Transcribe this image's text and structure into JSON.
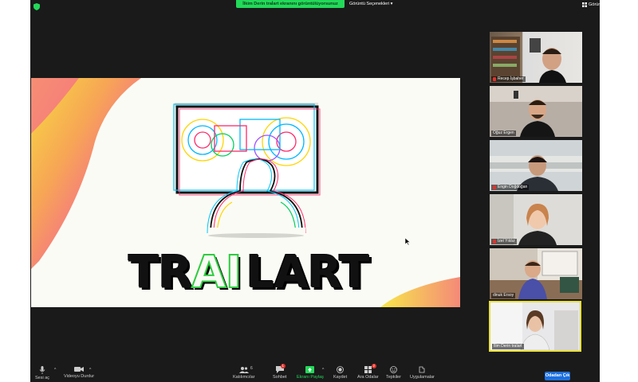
{
  "meeting": {
    "share_banner": "İlkim Derin traİart ekranını görüntülüyorsunuz",
    "view_options": "Görüntü Seçenekleri",
    "view_button": "Görünüm"
  },
  "slide": {
    "title_parts": [
      "TR",
      "AI",
      "LART"
    ]
  },
  "participants": [
    {
      "name": "Recep İşbaher",
      "muted": true
    },
    {
      "name": "Oğuz Ergen",
      "muted": false
    },
    {
      "name": "Engin Doğdoğan",
      "muted": true
    },
    {
      "name": "İzel Yıldız",
      "muted": true
    },
    {
      "name": "dinuk Ersoy",
      "muted": false
    },
    {
      "name": "İlim Derin traİart",
      "muted": false
    }
  ],
  "toolbar": {
    "mute_label": "Sesi aç",
    "video_label": "Videoyu Durdur",
    "participants_label": "Katılımcılar",
    "participants_count": "6",
    "chat_label": "Sohbet",
    "chat_badge": "1",
    "share_label": "Ekranı Paylaş",
    "record_label": "Kaydet",
    "breakout_label": "Ara Odalar",
    "breakout_badge": "2",
    "reactions_label": "Tepkiler",
    "apps_label": "Uygulamalar",
    "leave_label": "Odadan Çık"
  },
  "colors": {
    "share_green": "#23d959",
    "active_speaker": "#e9df3a",
    "leave_blue": "#1d6fe0",
    "title_green": "#2ecc40"
  }
}
